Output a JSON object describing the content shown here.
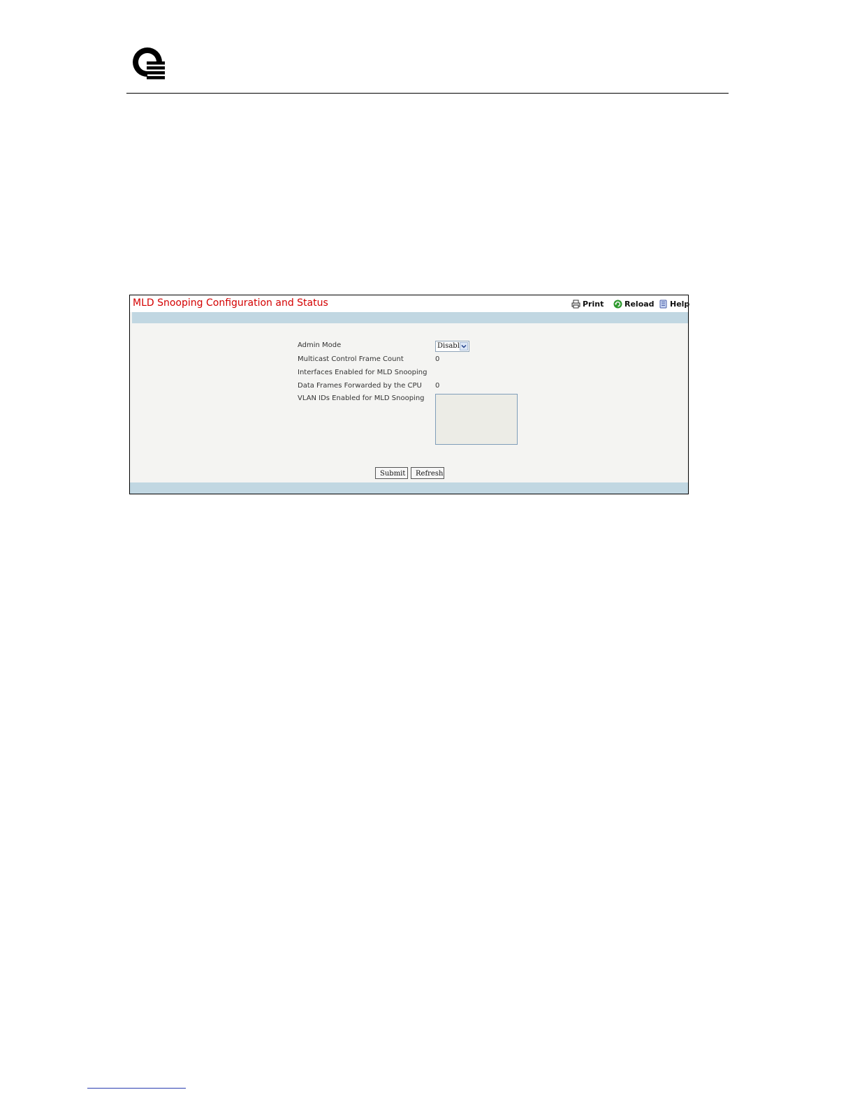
{
  "panel": {
    "title": "MLD Snooping Configuration and Status",
    "toolbar": {
      "print_label": "Print",
      "reload_label": "Reload",
      "help_label": "Help"
    }
  },
  "fields": [
    {
      "label": "Admin Mode",
      "value": "Disable"
    },
    {
      "label": "Multicast Control Frame Count",
      "value": "0"
    },
    {
      "label": "Interfaces Enabled for MLD Snooping",
      "value": ""
    },
    {
      "label": "Data Frames Forwarded by the CPU",
      "value": "0"
    },
    {
      "label": "VLAN IDs Enabled for MLD Snooping",
      "value": ""
    }
  ],
  "admin_mode": {
    "selected": "Disable"
  },
  "buttons": {
    "submit_label": "Submit",
    "refresh_label": "Refresh"
  },
  "colors": {
    "title_red": "#d40000",
    "band_blue": "#c1d7e2",
    "panel_bg": "#f4f4f2",
    "reload_green": "#2e9a2e"
  }
}
